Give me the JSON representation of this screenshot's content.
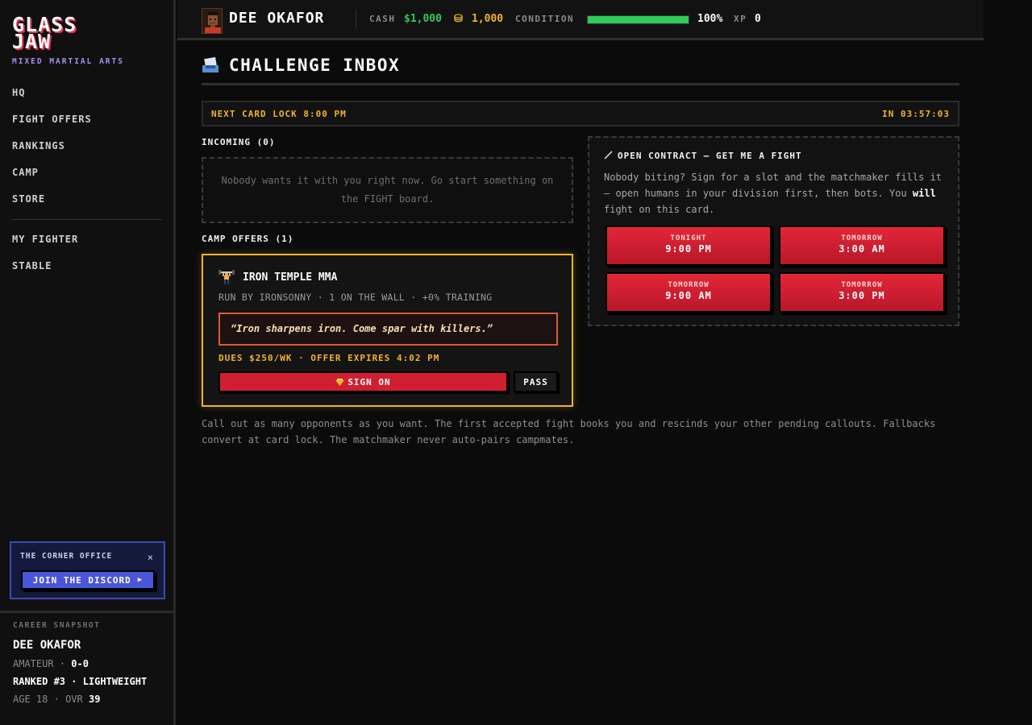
{
  "sidebar": {
    "logo_line1": "GLASS",
    "logo_line2": "JAW",
    "logo_sub": "MIXED MARTIAL ARTS",
    "nav": [
      "HQ",
      "FIGHT OFFERS",
      "RANKINGS",
      "CAMP",
      "STORE"
    ],
    "nav2": [
      "MY FIGHTER",
      "STABLE"
    ],
    "promo": {
      "title": "THE CORNER OFFICE",
      "close": "×",
      "button": "JOIN THE DISCORD",
      "button_arrow": "▶"
    },
    "snapshot": {
      "label": "CAREER SNAPSHOT",
      "name": "DEE OKAFOR",
      "level": "AMATEUR",
      "record": "0-0",
      "rank_line": "RANKED #3 · LIGHTWEIGHT",
      "age": "AGE 18",
      "ovr_label": "OVR",
      "ovr": "39",
      "sep": "·"
    }
  },
  "topbar": {
    "name": "DEE OKAFOR",
    "cash_label": "CASH",
    "cash_value": "$1,000",
    "coin_icon": "⛁",
    "coins": "1,000",
    "condition_label": "CONDITION",
    "condition_value": "100%",
    "condition_level": 1.0,
    "xp_label": "XP",
    "xp_value": "0"
  },
  "main": {
    "title": "CHALLENGE INBOX",
    "lock_left": "NEXT CARD LOCK 8:00 PM",
    "lock_right": "IN 03:57:03",
    "incoming_label": "INCOMING (0)",
    "incoming_empty": "Nobody wants it with you right now. Go start something on the FIGHT board.",
    "camp_label": "CAMP OFFERS (1)",
    "offer": {
      "gym": "IRON TEMPLE MMA",
      "meta": "RUN BY IRONSONNY · 1 ON THE WALL · +0% TRAINING",
      "quote": "“Iron sharpens iron. Come spar with killers.”",
      "dues": "DUES $250/WK · OFFER EXPIRES 4:02 PM",
      "sign_label": "SIGN ON",
      "pass_label": "PASS"
    },
    "contract": {
      "title": "OPEN CONTRACT — GET ME A FIGHT",
      "desc_before": "Nobody biting? Sign for a slot and the matchmaker fills it — open humans in your division first, then bots. You ",
      "desc_bold": "will",
      "desc_after": " fight on this card.",
      "slots": [
        {
          "day": "TONIGHT",
          "time": "9:00 PM"
        },
        {
          "day": "TOMORROW",
          "time": "3:00 AM"
        },
        {
          "day": "TOMORROW",
          "time": "9:00 AM"
        },
        {
          "day": "TOMORROW",
          "time": "3:00 PM"
        }
      ]
    },
    "footnote": "Call out as many opponents as you want. The first accepted fight books you and rescinds your other pending callouts. Fallbacks convert at card lock. The matchmaker never auto-pairs campmates."
  },
  "colors": {
    "accent_gold": "#f0b429",
    "accent_red": "#d01f30",
    "condition_green": "#2ecc5a",
    "discord_blue": "#4a55d8"
  }
}
